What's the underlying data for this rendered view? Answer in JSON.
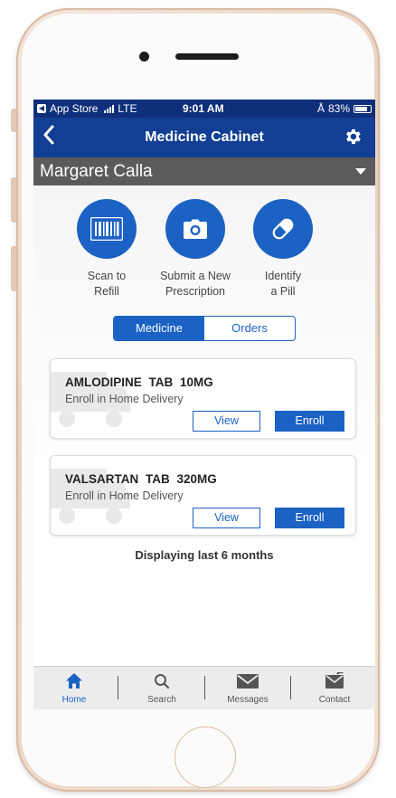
{
  "status_bar": {
    "back_app": "App Store",
    "network": "LTE",
    "time": "9:01 AM",
    "battery": "83%",
    "battery_level": 0.83
  },
  "nav": {
    "title": "Medicine Cabinet",
    "back_icon": "chevron-left-icon",
    "settings_icon": "gear-icon"
  },
  "patient": {
    "name": "Margaret Calla"
  },
  "actions": [
    {
      "label_line1": "Scan to",
      "label_line2": "Refill",
      "icon": "barcode-icon"
    },
    {
      "label_line1": "Submit a New",
      "label_line2": "Prescription",
      "icon": "camera-icon"
    },
    {
      "label_line1": "Identify",
      "label_line2": "a Pill",
      "icon": "pill-icon"
    }
  ],
  "segment": {
    "left": "Medicine",
    "right": "Orders",
    "selected": "Medicine"
  },
  "medications": [
    {
      "name": "AMLODIPINE TAB 10MG",
      "subtitle": "Enroll in Home Delivery",
      "view_label": "View",
      "enroll_label": "Enroll"
    },
    {
      "name": "VALSARTAN TAB 320MG",
      "subtitle": "Enroll in Home Delivery",
      "view_label": "View",
      "enroll_label": "Enroll"
    }
  ],
  "footer": {
    "text": "Displaying last 6 months"
  },
  "tabs": [
    {
      "label": "Home",
      "icon": "home-icon",
      "active": true
    },
    {
      "label": "Search",
      "icon": "search-icon",
      "active": false
    },
    {
      "label": "Messages",
      "icon": "envelope-icon",
      "active": false
    },
    {
      "label": "Contact",
      "icon": "contact-icon",
      "active": false
    }
  ],
  "colors": {
    "nav_bar": "#123e93",
    "status_bar": "#0f2f7a",
    "primary": "#1b62c4",
    "patient_bar": "#5b5b5b",
    "phone_frame": "#f1e2d6"
  }
}
